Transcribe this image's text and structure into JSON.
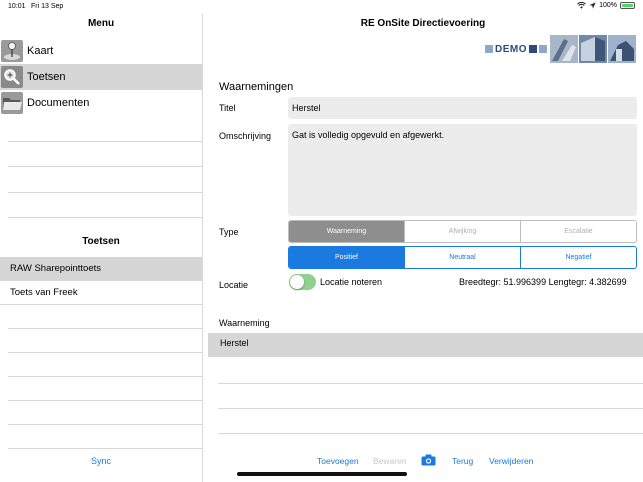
{
  "status": {
    "time": "10:01",
    "date": "Fri 13 Sep",
    "battery": "100%"
  },
  "sidebar": {
    "title": "Menu",
    "items": [
      {
        "label": "Kaart",
        "icon": "map-pin-icon",
        "selected": false
      },
      {
        "label": "Toetsen",
        "icon": "search-icon",
        "selected": true
      },
      {
        "label": "Documenten",
        "icon": "folder-icon",
        "selected": false
      }
    ],
    "toetsen_title": "Toetsen",
    "toetsen": [
      {
        "label": "RAW Sharepointtoets",
        "selected": true
      },
      {
        "label": "Toets van Freek",
        "selected": false
      }
    ],
    "sync_label": "Sync"
  },
  "main": {
    "title": "RE OnSite Directievoering",
    "logo_text": "DEMO",
    "section_title": "Waarnemingen",
    "titel_label": "Titel",
    "titel_value": "Herstel",
    "omschrijving_label": "Omschrijving",
    "omschrijving_value": "Gat is volledig opgevuld en afgewerkt.",
    "type_label": "Type",
    "type_options": [
      "Waarneming",
      "Afwijking",
      "Escalatie"
    ],
    "type_selected": 0,
    "polarity_options": [
      "Positief",
      "Neutraal",
      "Negatief"
    ],
    "polarity_selected": 0,
    "locatie_label": "Locatie",
    "locatie_toggle_label": "Locatie noteren",
    "locatie_toggle_on": true,
    "coordinates": "Breedtegr: 51.996399 Lengtegr: 4.382699",
    "waarneming_label": "Waarneming",
    "waarneming_items": [
      "Herstel"
    ]
  },
  "toolbar": {
    "add_label": "Toevoegen",
    "save_label": "Bewaren",
    "back_label": "Terug",
    "delete_label": "Verwijderen"
  },
  "colors": {
    "accent": "#1b7ae0",
    "selected_bg": "#d6d6d6",
    "toggle_on": "#8fd18d",
    "logo_blue": "#2c4a7e"
  }
}
